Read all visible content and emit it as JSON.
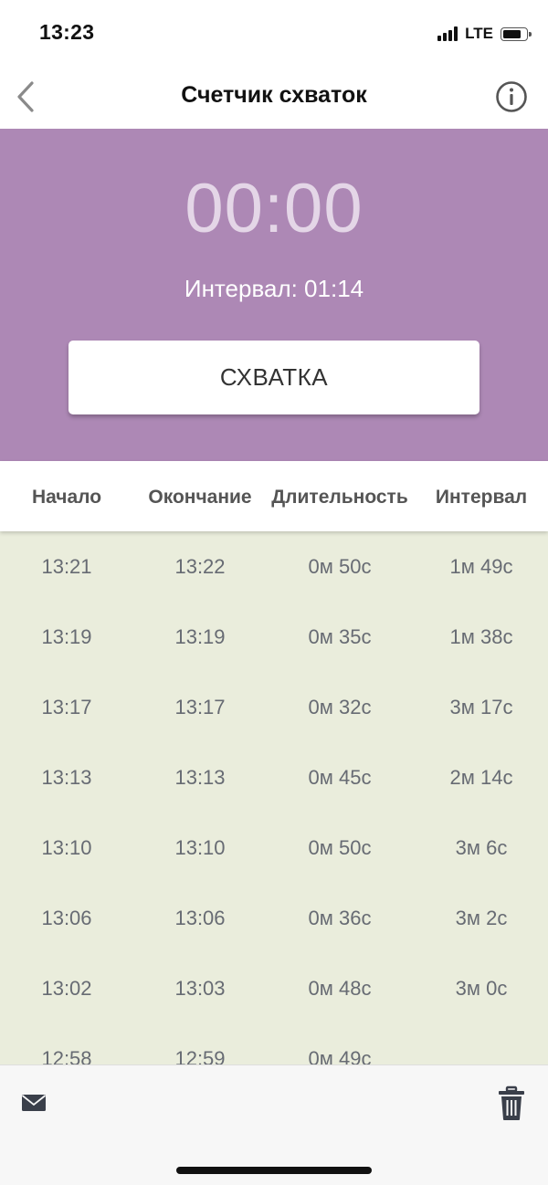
{
  "status_bar": {
    "time": "13:23",
    "network": "LTE"
  },
  "nav": {
    "title": "Счетчик схваток",
    "back_icon": "chevron-left-icon",
    "info_icon": "info-circle-icon"
  },
  "timer": {
    "display": "00:00",
    "interval_text": "Интервал: 01:14",
    "button_label": "СХВАТКА"
  },
  "table": {
    "headers": [
      "Начало",
      "Окончание",
      "Длительность",
      "Интервал"
    ],
    "rows": [
      [
        "13:21",
        "13:22",
        "0м 50с",
        "1м 49с"
      ],
      [
        "13:19",
        "13:19",
        "0м 35с",
        "1м 38с"
      ],
      [
        "13:17",
        "13:17",
        "0м 32с",
        "3м 17с"
      ],
      [
        "13:13",
        "13:13",
        "0м 45с",
        "2м 14с"
      ],
      [
        "13:10",
        "13:10",
        "0м 50с",
        "3м 6с"
      ],
      [
        "13:06",
        "13:06",
        "0м 36с",
        "3м 2с"
      ],
      [
        "13:02",
        "13:03",
        "0м 48с",
        "3м 0с"
      ],
      [
        "12:58",
        "12:59",
        "0м 49с",
        ""
      ]
    ]
  },
  "bottom_bar": {
    "mail_icon": "envelope-icon",
    "trash_icon": "trash-icon"
  },
  "colors": {
    "panel": "#ad88b5",
    "table_bg": "#eaeddc",
    "timer_text": "#e4d6e7"
  }
}
